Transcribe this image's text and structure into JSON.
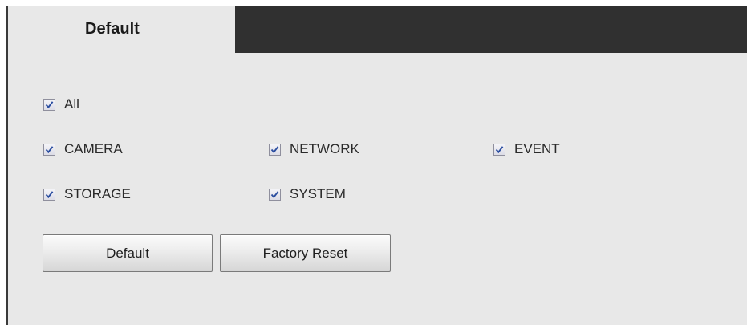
{
  "tab": {
    "label": "Default"
  },
  "options": [
    {
      "id": "all",
      "label": "All",
      "checked": true
    },
    {
      "id": "camera",
      "label": "CAMERA",
      "checked": true
    },
    {
      "id": "network",
      "label": "NETWORK",
      "checked": true
    },
    {
      "id": "event",
      "label": "EVENT",
      "checked": true
    },
    {
      "id": "storage",
      "label": "STORAGE",
      "checked": true
    },
    {
      "id": "system",
      "label": "SYSTEM",
      "checked": true
    }
  ],
  "buttons": {
    "default_label": "Default",
    "factory_reset_label": "Factory Reset"
  },
  "colors": {
    "tab_bar": "#303030",
    "panel": "#e8e8e8",
    "check_mark": "#2b4ea0"
  }
}
